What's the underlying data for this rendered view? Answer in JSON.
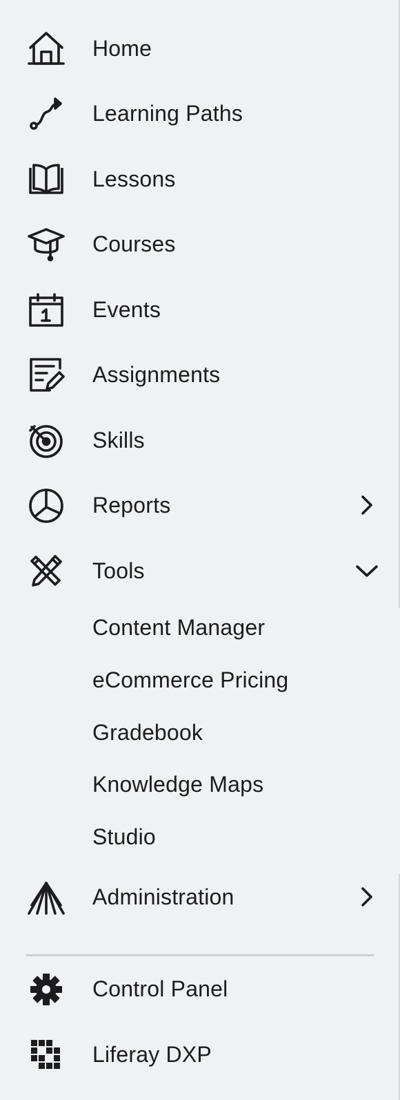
{
  "nav": {
    "items": [
      {
        "label": "Home",
        "icon": "home-icon"
      },
      {
        "label": "Learning Paths",
        "icon": "learning-path-icon"
      },
      {
        "label": "Lessons",
        "icon": "book-icon"
      },
      {
        "label": "Courses",
        "icon": "graduation-cap-icon"
      },
      {
        "label": "Events",
        "icon": "calendar-icon"
      },
      {
        "label": "Assignments",
        "icon": "assignment-icon"
      },
      {
        "label": "Skills",
        "icon": "target-icon"
      },
      {
        "label": "Reports",
        "icon": "pie-chart-icon",
        "expander": "chevron-right-icon"
      },
      {
        "label": "Tools",
        "icon": "tools-icon",
        "expander": "chevron-down-icon"
      }
    ],
    "tools_subitems": [
      {
        "label": "Content Manager"
      },
      {
        "label": "eCommerce Pricing"
      },
      {
        "label": "Gradebook"
      },
      {
        "label": "Knowledge Maps"
      },
      {
        "label": "Studio"
      }
    ],
    "administration": {
      "label": "Administration",
      "icon": "administration-icon",
      "expander": "chevron-right-icon"
    },
    "footer_items": [
      {
        "label": "Control Panel",
        "icon": "gear-icon"
      },
      {
        "label": "Liferay DXP",
        "icon": "liferay-logo-icon"
      }
    ]
  },
  "colors": {
    "background": "#f0f1f3",
    "text": "#1c1c1e",
    "divider": "#cbcdd1"
  }
}
